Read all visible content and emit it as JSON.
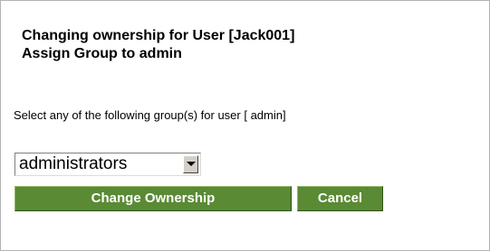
{
  "heading": {
    "line1": "Changing ownership for User [Jack001]",
    "line2": "Assign Group to admin"
  },
  "instruction": "Select any of the following group(s) for user [ admin]",
  "group_select": {
    "selected": "administrators",
    "arrow_icon": "chevron-down-icon"
  },
  "buttons": {
    "change_ownership": "Change Ownership",
    "cancel": "Cancel"
  },
  "colors": {
    "button_bg": "#5a8a34",
    "button_text": "#ffffff"
  }
}
